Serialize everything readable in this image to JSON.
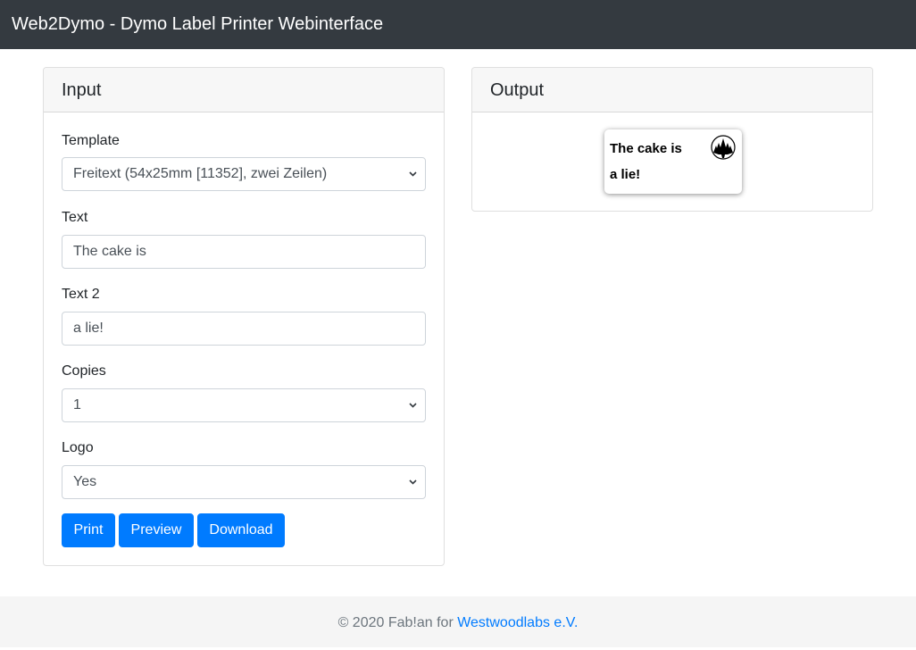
{
  "navbar": {
    "title": "Web2Dymo - Dymo Label Printer Webinterface"
  },
  "input_card": {
    "header": "Input",
    "fields": {
      "template": {
        "label": "Template",
        "value": "Freitext (54x25mm [11352], zwei Zeilen)",
        "icon": "chevron-down-icon"
      },
      "text": {
        "label": "Text",
        "value": "The cake is"
      },
      "text2": {
        "label": "Text 2",
        "value": "a lie!"
      },
      "copies": {
        "label": "Copies",
        "value": "1",
        "icon": "chevron-down-icon"
      },
      "logo": {
        "label": "Logo",
        "value": "Yes",
        "icon": "chevron-down-icon"
      }
    },
    "buttons": {
      "print": "Print",
      "preview": "Preview",
      "download": "Download"
    }
  },
  "output_card": {
    "header": "Output",
    "preview": {
      "line1": "The cake is",
      "line2": "a lie!",
      "logo_icon": "forest-logo-icon"
    }
  },
  "footer": {
    "prefix": "© 2020 Fab!an for ",
    "link_text": "Westwoodlabs e.V."
  },
  "colors": {
    "navbar": "#343a40",
    "primary": "#007bff",
    "footer_bg": "#f5f5f5"
  }
}
